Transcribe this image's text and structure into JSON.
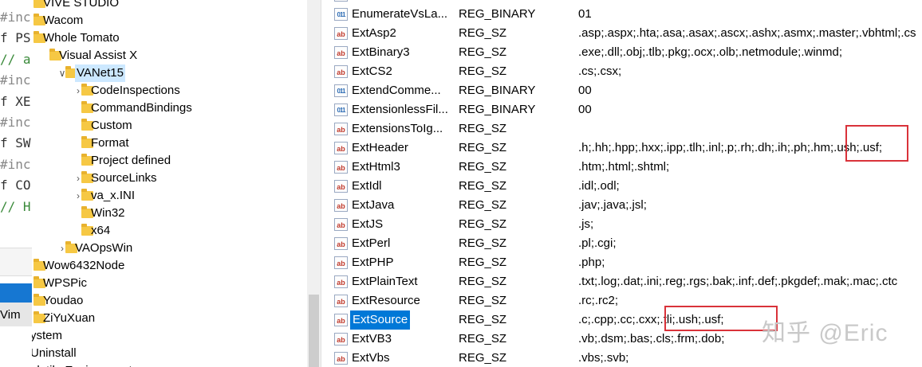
{
  "code_lines": [
    {
      "text": "#inc",
      "cls": "pp"
    },
    {
      "text": "f PS",
      "cls": "kw"
    },
    {
      "text": "// a",
      "cls": "cm"
    },
    {
      "text": "#inc",
      "cls": "pp"
    },
    {
      "text": "f XE",
      "cls": "kw"
    },
    {
      "text": "#inc",
      "cls": "pp"
    },
    {
      "text": "f SW",
      "cls": "kw"
    },
    {
      "text": "#inc",
      "cls": "pp"
    },
    {
      "text": "f CO",
      "cls": "kw"
    },
    {
      "text": "// H",
      "cls": "cm"
    }
  ],
  "left_bottom": {
    "vim": "Vim"
  },
  "tree": [
    {
      "label": "VIVE STUDIO",
      "folder": true,
      "chev": ""
    },
    {
      "label": "Wacom",
      "folder": true,
      "chev": ""
    },
    {
      "label": "Whole Tomato",
      "folder": true,
      "chev": ""
    },
    {
      "label": "Visual Assist X",
      "folder": true,
      "chev": ""
    },
    {
      "label": "VANet15",
      "folder": true,
      "chev": "∨",
      "selected": true
    },
    {
      "label": "CodeInspections",
      "folder": true,
      "chev": "›"
    },
    {
      "label": "CommandBindings",
      "folder": true,
      "chev": ""
    },
    {
      "label": "Custom",
      "folder": true,
      "chev": ""
    },
    {
      "label": "Format",
      "folder": true,
      "chev": ""
    },
    {
      "label": "Project defined",
      "folder": true,
      "chev": ""
    },
    {
      "label": "SourceLinks",
      "folder": true,
      "chev": "›"
    },
    {
      "label": "va_x.INI",
      "folder": true,
      "chev": "›"
    },
    {
      "label": "Win32",
      "folder": true,
      "chev": ""
    },
    {
      "label": "x64",
      "folder": true,
      "chev": ""
    },
    {
      "label": "VAOpsWin",
      "folder": true,
      "chev": "›"
    },
    {
      "label": "Wow6432Node",
      "folder": true,
      "chev": ""
    },
    {
      "label": "WPSPic",
      "folder": true,
      "chev": ""
    },
    {
      "label": "Youdao",
      "folder": true,
      "chev": ""
    },
    {
      "label": "ZiYuXuan",
      "folder": true,
      "chev": ""
    },
    {
      "label": "ystem",
      "folder": false,
      "chev": ""
    },
    {
      "label": "Uninstall",
      "folder": false,
      "chev": ""
    },
    {
      "label": "olatile Environment",
      "folder": false,
      "chev": ""
    }
  ],
  "values": [
    {
      "name": "",
      "type": "",
      "data": "",
      "icon": "bin"
    },
    {
      "name": "EnumerateVsLa...",
      "type": "REG_BINARY",
      "data": "01",
      "icon": "bin"
    },
    {
      "name": "ExtAsp2",
      "type": "REG_SZ",
      "data": ".asp;.aspx;.hta;.asa;.asax;.ascx;.ashx;.asmx;.master;.vbhtml;.cs",
      "icon": "sz"
    },
    {
      "name": "ExtBinary3",
      "type": "REG_SZ",
      "data": ".exe;.dll;.obj;.tlb;.pkg;.ocx;.olb;.netmodule;.winmd;",
      "icon": "sz"
    },
    {
      "name": "ExtCS2",
      "type": "REG_SZ",
      "data": ".cs;.csx;",
      "icon": "sz"
    },
    {
      "name": "ExtendComme...",
      "type": "REG_BINARY",
      "data": "00",
      "icon": "bin"
    },
    {
      "name": "ExtensionlessFil...",
      "type": "REG_BINARY",
      "data": "00",
      "icon": "bin"
    },
    {
      "name": "ExtensionsToIg...",
      "type": "REG_SZ",
      "data": "",
      "icon": "sz"
    },
    {
      "name": "ExtHeader",
      "type": "REG_SZ",
      "data": ".h;.hh;.hpp;.hxx;.ipp;.tlh;.inl;.p;.rh;.dh;.ih;.ph;.hm;.ush;.usf;",
      "icon": "sz"
    },
    {
      "name": "ExtHtml3",
      "type": "REG_SZ",
      "data": ".htm;.html;.shtml;",
      "icon": "sz"
    },
    {
      "name": "ExtIdl",
      "type": "REG_SZ",
      "data": ".idl;.odl;",
      "icon": "sz"
    },
    {
      "name": "ExtJava",
      "type": "REG_SZ",
      "data": ".jav;.java;.jsl;",
      "icon": "sz"
    },
    {
      "name": "ExtJS",
      "type": "REG_SZ",
      "data": ".js;",
      "icon": "sz"
    },
    {
      "name": "ExtPerl",
      "type": "REG_SZ",
      "data": ".pl;.cgi;",
      "icon": "sz"
    },
    {
      "name": "ExtPHP",
      "type": "REG_SZ",
      "data": ".php;",
      "icon": "sz"
    },
    {
      "name": "ExtPlainText",
      "type": "REG_SZ",
      "data": ".txt;.log;.dat;.ini;.reg;.rgs;.bak;.inf;.def;.pkgdef;.mak;.mac;.ctc",
      "icon": "sz"
    },
    {
      "name": "ExtResource",
      "type": "REG_SZ",
      "data": ".rc;.rc2;",
      "icon": "sz"
    },
    {
      "name": "ExtSource",
      "type": "REG_SZ",
      "data": ".c;.cpp;.cc;.cxx;.tli;.ush;.usf;",
      "icon": "sz",
      "selected": true
    },
    {
      "name": "ExtVB3",
      "type": "REG_SZ",
      "data": ".vb;.dsm;.bas;.cls;.frm;.dob;",
      "icon": "sz"
    },
    {
      "name": "ExtVbs",
      "type": "REG_SZ",
      "data": ".vbs;.svb;",
      "icon": "sz"
    }
  ],
  "icon_glyphs": {
    "sz": "ab",
    "bin": "011"
  },
  "watermark": "知乎 @Eric",
  "colors": {
    "selection": "#0078d7",
    "highlight_box": "#d9323a",
    "folder": "#f6c844"
  }
}
